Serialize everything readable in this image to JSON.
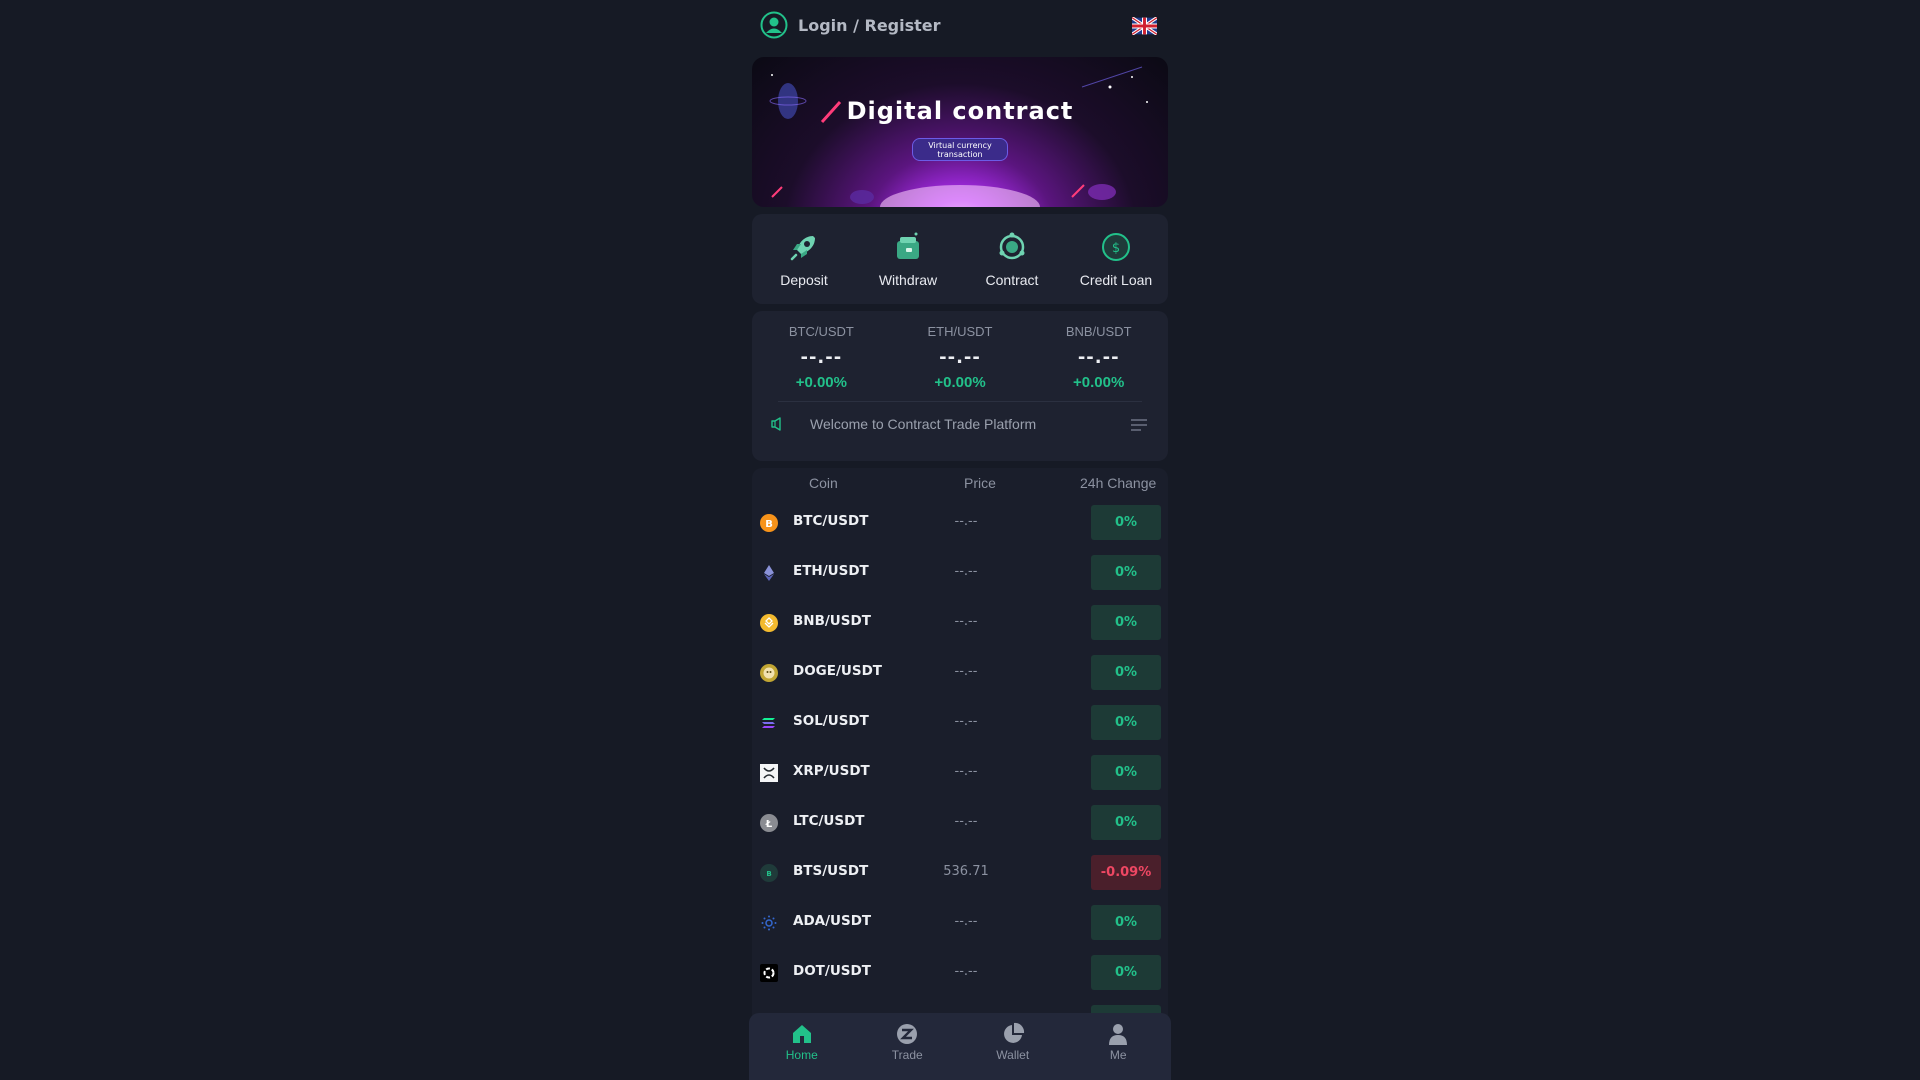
{
  "header": {
    "login_label": "Login / Register",
    "language_icon": "uk-flag-icon"
  },
  "banner": {
    "title": "Digital contract",
    "subtitle_line1": "Virtual currency",
    "subtitle_line2": "transaction"
  },
  "quick_actions": [
    {
      "label": "Deposit",
      "icon": "rocket-icon"
    },
    {
      "label": "Withdraw",
      "icon": "wallet-icon"
    },
    {
      "label": "Contract",
      "icon": "contract-icon"
    },
    {
      "label": "Credit Loan",
      "icon": "dollar-coin-icon"
    }
  ],
  "tickers": [
    {
      "pair": "BTC/USDT",
      "price": "--.--",
      "change": "+0.00%"
    },
    {
      "pair": "ETH/USDT",
      "price": "--.--",
      "change": "+0.00%"
    },
    {
      "pair": "BNB/USDT",
      "price": "--.--",
      "change": "+0.00%"
    }
  ],
  "notice": {
    "text": "Welcome to Contract Trade Platform"
  },
  "market": {
    "headers": {
      "coin": "Coin",
      "price": "Price",
      "change": "24h Change"
    },
    "rows": [
      {
        "symbol": "BTC/USDT",
        "price": "--.--",
        "change": "0%",
        "icon": "btc-icon"
      },
      {
        "symbol": "ETH/USDT",
        "price": "--.--",
        "change": "0%",
        "icon": "eth-icon"
      },
      {
        "symbol": "BNB/USDT",
        "price": "--.--",
        "change": "0%",
        "icon": "bnb-icon"
      },
      {
        "symbol": "DOGE/USDT",
        "price": "--.--",
        "change": "0%",
        "icon": "doge-icon"
      },
      {
        "symbol": "SOL/USDT",
        "price": "--.--",
        "change": "0%",
        "icon": "sol-icon"
      },
      {
        "symbol": "XRP/USDT",
        "price": "--.--",
        "change": "0%",
        "icon": "xrp-icon"
      },
      {
        "symbol": "LTC/USDT",
        "price": "--.--",
        "change": "0%",
        "icon": "ltc-icon"
      },
      {
        "symbol": "BTS/USDT",
        "price": "536.71",
        "change": "-0.09%",
        "icon": "bts-icon"
      },
      {
        "symbol": "ADA/USDT",
        "price": "--.--",
        "change": "0%",
        "icon": "ada-icon"
      },
      {
        "symbol": "DOT/USDT",
        "price": "--.--",
        "change": "0%",
        "icon": "dot-icon"
      }
    ]
  },
  "tabbar": [
    {
      "label": "Home",
      "icon": "home-icon",
      "active": true
    },
    {
      "label": "Trade",
      "icon": "trade-icon",
      "active": false
    },
    {
      "label": "Wallet",
      "icon": "wallet-pie-icon",
      "active": false
    },
    {
      "label": "Me",
      "icon": "user-icon",
      "active": false
    }
  ],
  "colors": {
    "background": "#161a25",
    "card": "#1e2230",
    "up": "#22c18a",
    "down": "#ef4763"
  }
}
